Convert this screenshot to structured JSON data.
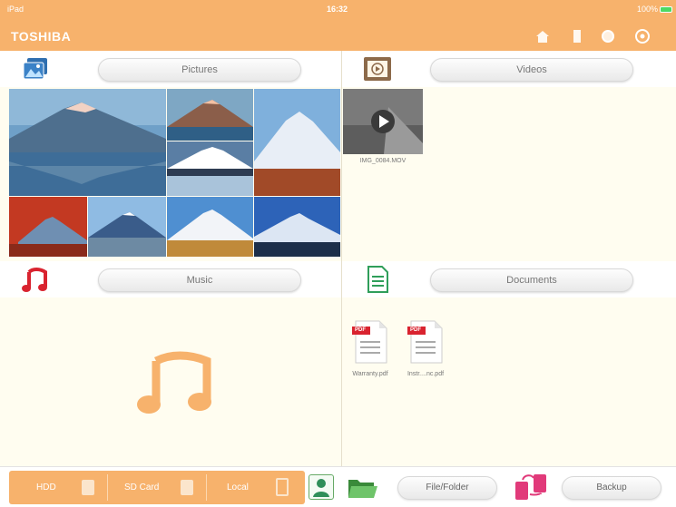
{
  "status_bar": {
    "carrier": "iPad",
    "time": "16:32",
    "battery": "100%"
  },
  "app": {
    "title": "TOSHIBA"
  },
  "header_icons": [
    "home-icon",
    "sd-card-icon",
    "refresh-icon",
    "settings-icon"
  ],
  "pictures": {
    "button_label": "Pictures"
  },
  "videos": {
    "button_label": "Videos",
    "items": [
      {
        "name": "IMG_0084.MOV"
      }
    ]
  },
  "music": {
    "button_label": "Music"
  },
  "documents": {
    "button_label": "Documents",
    "items": [
      {
        "name": "Warranty.pdf",
        "badge": "PDF"
      },
      {
        "name": "Instr....nc.pdf",
        "badge": "PDF"
      }
    ]
  },
  "bottom_bar": {
    "tabs": [
      {
        "label": "HDD"
      },
      {
        "label": "SD Card"
      },
      {
        "label": "Local"
      }
    ],
    "file_folder_label": "File/Folder",
    "backup_label": "Backup"
  },
  "colors": {
    "accent": "#f7b26c",
    "music_icon": "#d9232f",
    "background": "#fffdf0"
  }
}
